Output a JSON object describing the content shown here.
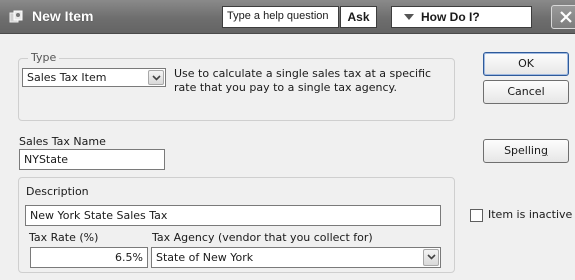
{
  "window": {
    "title": "New Item",
    "help_placeholder": "Type a help question",
    "ask_label": "Ask",
    "how_do_label": "How Do I?"
  },
  "type_group": {
    "label": "Type",
    "selected": "Sales Tax Item",
    "description": "Use to calculate a single sales tax at a specific rate that you pay to a single tax agency."
  },
  "sales_tax_name": {
    "label": "Sales Tax Name",
    "value": "NYState"
  },
  "details": {
    "description_label": "Description",
    "description_value": "New York State Sales Tax",
    "tax_rate_label": "Tax Rate (%)",
    "tax_rate_value": "6.5%",
    "tax_agency_label": "Tax Agency (vendor that you collect for)",
    "tax_agency_value": "State of New York"
  },
  "buttons": {
    "ok": "OK",
    "cancel": "Cancel",
    "spelling_prefix": "Spellin",
    "spelling_accel": "g"
  },
  "inactive": {
    "label": "Item is inactive",
    "checked": false
  }
}
